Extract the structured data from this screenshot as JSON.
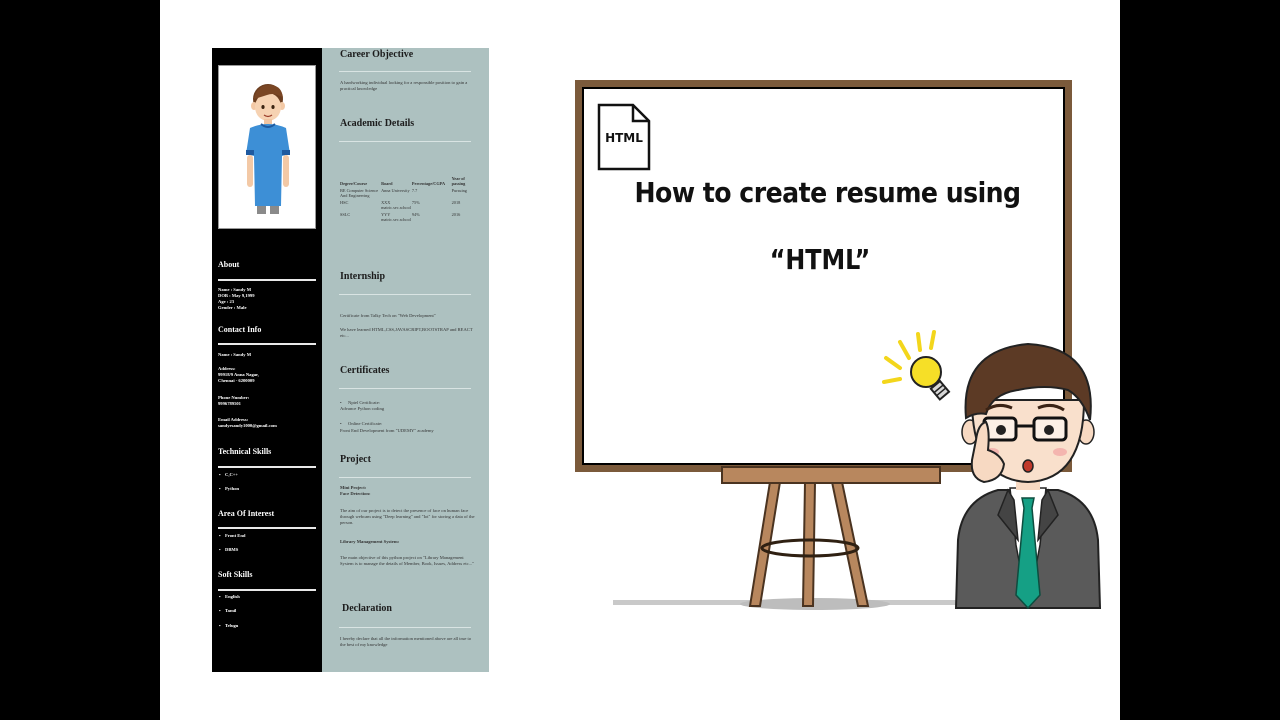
{
  "resume": {
    "sidebar": {
      "about": {
        "heading": "About",
        "lines": [
          "Name : Sandy M",
          "DOB : May 9,1999",
          "Age : 23",
          "Gender : Male"
        ]
      },
      "contact": {
        "heading": "Contact Info",
        "name": "Name : Sandy M",
        "address_label": "Address:",
        "address_lines": [
          "99918/9 Anna Nagar,",
          "Chennai - 6200009"
        ],
        "phone_label": "Phone Number:",
        "phone": "9996789501",
        "email_label": "Email Address:",
        "email": "sandyrsandy1000@gmail.com"
      },
      "technical_skills": {
        "heading": "Technical Skills",
        "items": [
          "C,C++",
          "Python"
        ]
      },
      "area_of_interest": {
        "heading": "Area Of Interest",
        "items": [
          "Front End",
          "DBMS"
        ]
      },
      "soft_skills": {
        "heading": "Soft Skills",
        "items": [
          "English",
          "Tamil",
          "Telugu"
        ]
      }
    },
    "main": {
      "career": {
        "heading": "Career Objective",
        "text": "A hardworking individual looking for a responsible position to gain a practical knowledge"
      },
      "academic": {
        "heading": "Academic Details",
        "columns": [
          "Degree/Course",
          "Board",
          "Percentage/CGPA",
          "Year of passing"
        ],
        "rows": [
          [
            "BE Computer Science And Engineering",
            "Anna University",
            "7.7",
            "Pursuing"
          ],
          [
            "HSC",
            "XXX matric.sec.school",
            "75%",
            "2018"
          ],
          [
            "SSLC",
            "YYY matric.sec.school",
            "94%",
            "2016"
          ]
        ]
      },
      "internship": {
        "heading": "Internship",
        "text1": "Certificate from Talky Tech on \"Web Development\"",
        "text2": "We have learned HTML,CSS,JAVASCRIPT,BOOTSTRAP and REACT etc..."
      },
      "certificates": {
        "heading": "Certificates",
        "item1_label": "Nptel Certificate:",
        "item1_text": "Advance Python coding",
        "item2_label": "Online Certificate:",
        "item2_text": "Front End Development from \"UDEMY\" academy"
      },
      "project": {
        "heading": "Project",
        "mini_label": "Mini Project:",
        "mini_title": "Face Detection:",
        "mini_text": "The aim of our project is to detect the presence of face on human face through webcam using \"Deep learning\" and \"Iot\" for storing a data of the person.",
        "lib_title": "Library Management System:",
        "lib_text": "The main objective of this python project on \"Library Management System is to manage the details of Member, Book, Issues, Address etc...\""
      },
      "declaration": {
        "heading": "Declaration",
        "text": "I hereby declare that all the information mentioned above are all true to the best of my knowledge"
      }
    }
  },
  "whiteboard": {
    "doc_icon_label": "HTML",
    "title_line1": "How to create resume using",
    "title_line2": "“HTML”"
  },
  "colors": {
    "resume_sidebar": "#000000",
    "resume_main": "#adc1c0",
    "board_frame": "#7b5a3b",
    "easel_wood": "#b8875e",
    "tie": "#15a085"
  }
}
